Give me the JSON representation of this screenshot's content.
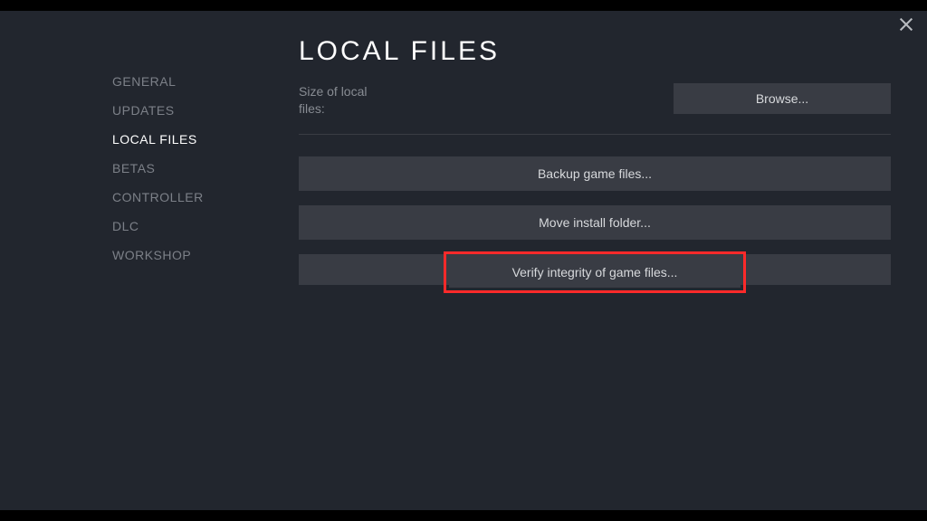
{
  "sidebar": {
    "items": [
      {
        "label": "GENERAL",
        "active": false
      },
      {
        "label": "UPDATES",
        "active": false
      },
      {
        "label": "LOCAL FILES",
        "active": true
      },
      {
        "label": "BETAS",
        "active": false
      },
      {
        "label": "CONTROLLER",
        "active": false
      },
      {
        "label": "DLC",
        "active": false
      },
      {
        "label": "WORKSHOP",
        "active": false
      }
    ]
  },
  "main": {
    "title": "LOCAL FILES",
    "size_label": "Size of local files:",
    "size_value": "",
    "browse_label": "Browse...",
    "buttons": {
      "backup": "Backup game files...",
      "move": "Move install folder...",
      "verify": "Verify integrity of game files..."
    }
  }
}
